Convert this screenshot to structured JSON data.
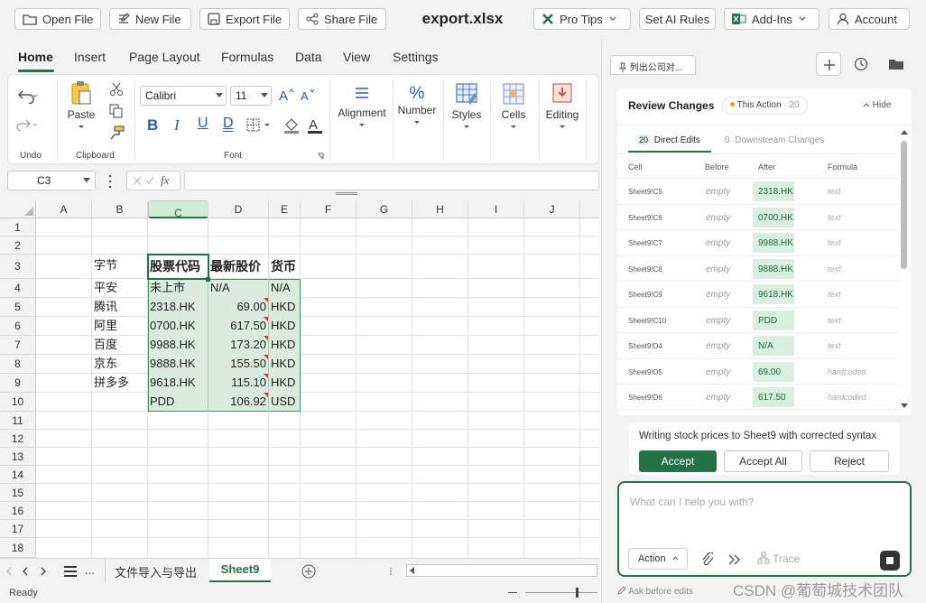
{
  "topbar": {
    "open_file": "Open File",
    "new_file": "New File",
    "export_file": "Export File",
    "share_file": "Share File",
    "title": "export.xlsx",
    "pro_tips": "Pro Tips",
    "set_ai_rules": "Set AI Rules",
    "add_ins": "Add-Ins",
    "account": "Account"
  },
  "ribbon_tabs": [
    "Home",
    "Insert",
    "Page Layout",
    "Formulas",
    "Data",
    "View",
    "Settings"
  ],
  "ribbon": {
    "undo_group": "Undo",
    "paste": "Paste",
    "clipboard_group": "Clipboard",
    "font_name": "Calibri",
    "font_size": "11",
    "font_group": "Font",
    "alignment": "Alignment",
    "number": "Number",
    "styles": "Styles",
    "cells": "Cells",
    "editing": "Editing"
  },
  "formula_bar": {
    "name_box": "C3",
    "fx": "fx",
    "value": ""
  },
  "grid": {
    "columns": [
      "A",
      "B",
      "C",
      "D",
      "E",
      "F",
      "G",
      "H",
      "I",
      "J"
    ],
    "rows": [
      "1",
      "2",
      "3",
      "4",
      "5",
      "6",
      "7",
      "8",
      "9",
      "10",
      "11",
      "12",
      "13",
      "14",
      "15",
      "16",
      "17",
      "18"
    ],
    "selected_column": "C",
    "b_col": [
      "字节",
      "平安",
      "腾讯",
      "阿里",
      "百度",
      "京东",
      "拼多多"
    ],
    "c_col": [
      "股票代码",
      "未上市",
      "2318.HK",
      "0700.HK",
      "9988.HK",
      "9888.HK",
      "9618.HK",
      "PDD"
    ],
    "d_col": [
      "最新股价",
      "N/A",
      "69.00",
      "617.50",
      "173.20",
      "155.50",
      "115.10",
      "106.92"
    ],
    "e_col": [
      "货币",
      "N/A",
      "HKD",
      "HKD",
      "HKD",
      "HKD",
      "HKD",
      "USD"
    ]
  },
  "sheets": {
    "tab1": "文件导入与导出",
    "tab2": "Sheet9",
    "more": "..."
  },
  "status": {
    "ready": "Ready"
  },
  "panel": {
    "chat_tab": "列出公司对...",
    "review_title": "Review Changes",
    "this_action": "This Action",
    "this_action_count": "· 20",
    "hide": "Hide",
    "direct_count": "20",
    "direct_edits": "Direct Edits",
    "downstream_count": "0",
    "downstream_changes": "Downstream Changes",
    "headers": [
      "Cell",
      "Before",
      "After",
      "Formula"
    ],
    "rows": [
      {
        "cell": "Sheet9!C5",
        "before": "empty",
        "after": "2318.HK",
        "formula": "text"
      },
      {
        "cell": "Sheet9!C6",
        "before": "empty",
        "after": "0700.HK",
        "formula": "text"
      },
      {
        "cell": "Sheet9!C7",
        "before": "empty",
        "after": "9988.HK",
        "formula": "text"
      },
      {
        "cell": "Sheet9!C8",
        "before": "empty",
        "after": "9888.HK",
        "formula": "text"
      },
      {
        "cell": "Sheet9!C9",
        "before": "empty",
        "after": "9618.HK",
        "formula": "text"
      },
      {
        "cell": "Sheet9!C10",
        "before": "empty",
        "after": "PDD",
        "formula": "text"
      },
      {
        "cell": "Sheet9!D4",
        "before": "empty",
        "after": "N/A",
        "formula": "text"
      },
      {
        "cell": "Sheet9!D5",
        "before": "empty",
        "after": "69.00",
        "formula": "hardcoded"
      },
      {
        "cell": "Sheet9!D6",
        "before": "empty",
        "after": "617.50",
        "formula": "hardcoded"
      }
    ],
    "message": "Writing stock prices to Sheet9 with corrected syntax",
    "accept": "Accept",
    "accept_all": "Accept All",
    "reject": "Reject",
    "chat_placeholder": "What can I help you with?",
    "action": "Action",
    "trace": "Trace",
    "ask_before_edits": "Ask before edits",
    "watermark": "CSDN @葡萄城技术团队"
  },
  "colors": {
    "accent": "#217346",
    "selection_fill": "#d9ecdf",
    "panel_highlight": "#d9efdf"
  }
}
